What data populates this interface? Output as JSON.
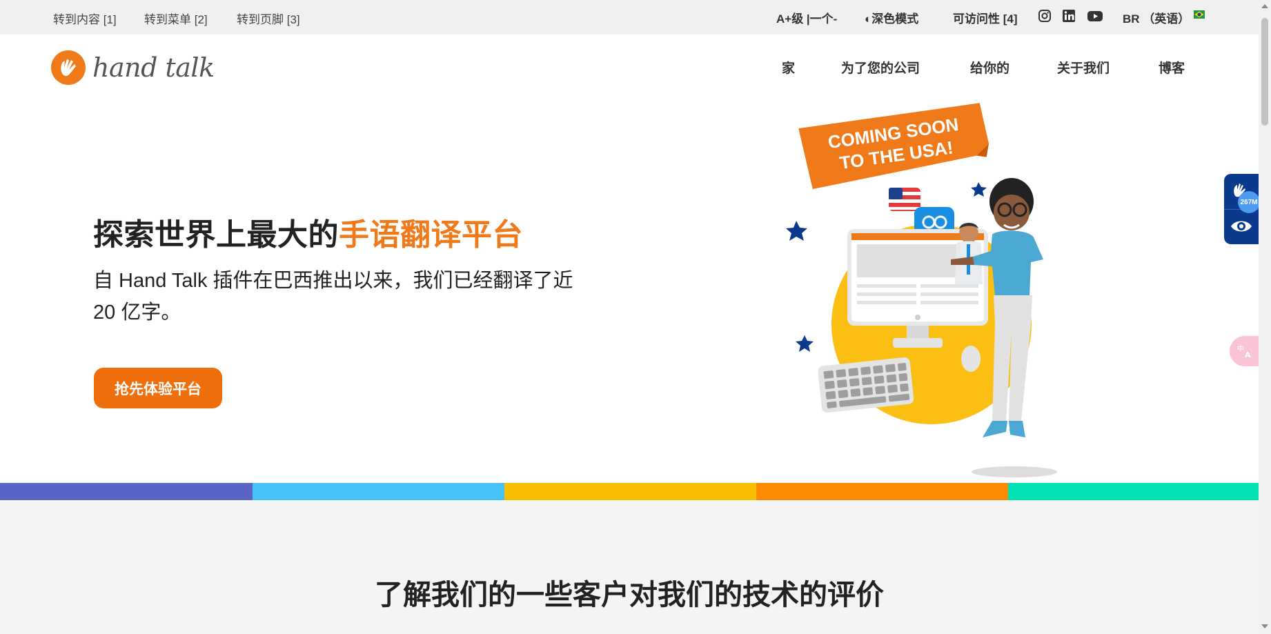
{
  "topbar": {
    "skip_content": "转到内容 [1]",
    "skip_menu": "转到菜单 [2]",
    "skip_footer": "转到页脚 [3]",
    "font_size": "A+级 |一个-",
    "dark_mode": "◐深色模式",
    "accessibility": "可访问性 [4]",
    "language": "BR （英语）"
  },
  "social_icons": [
    "instagram-icon",
    "linkedin-icon",
    "youtube-icon",
    "brazil-flag-icon"
  ],
  "logo": {
    "text": "hand talk"
  },
  "nav": {
    "home": "家",
    "companies": "为了您的公司",
    "you": "给你的",
    "about": "关于我们",
    "blog": "博客"
  },
  "hero": {
    "title_plain": "探索世界上最大的",
    "title_highlight": "手语翻译平台",
    "subtitle": "自 Hand Talk 插件在巴西推出以来，我们已经翻译了近 20 亿字。",
    "cta": "抢先体验平台"
  },
  "illustration": {
    "banner_line1": "COMING SOON",
    "banner_line2": "TO THE USA!"
  },
  "stripe_colors": [
    "#5b65c5",
    "#47c1f6",
    "#f7bf00",
    "#fd8a00",
    "#00e2b4"
  ],
  "colors": {
    "accent": "#f07a1a",
    "cta": "#ef6f0c",
    "widget": "#0b3a8c"
  },
  "section": {
    "title": "了解我们的一些客户对我们的技术的评价"
  },
  "widget": {
    "badge": "267M"
  }
}
